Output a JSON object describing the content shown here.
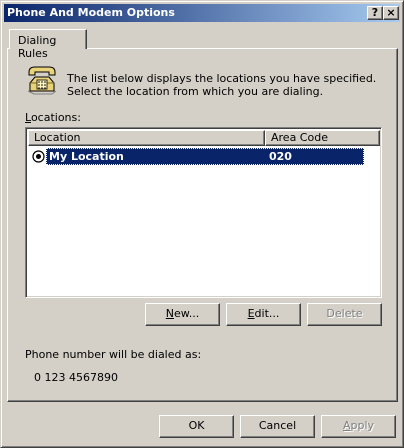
{
  "window": {
    "title": "Phone And Modem Options",
    "help_label": "?",
    "close_label": "×"
  },
  "tabs": [
    {
      "label": "Dialing Rules",
      "selected": true
    }
  ],
  "dialing_rules": {
    "description": "The list below displays the locations you have specified. Select the location from which you are dialing.",
    "locations_label_rest": "ocations:",
    "locations_label_mnemonic": "L",
    "columns": [
      "Location",
      "Area Code"
    ],
    "rows": [
      {
        "location": "My Location",
        "area_code": "020",
        "selected": true
      }
    ],
    "buttons": {
      "new_mnemonic": "N",
      "new_rest": "ew...",
      "edit_mnemonic": "E",
      "edit_rest": "dit...",
      "delete": "Delete"
    },
    "dial_as_label": "Phone number will be dialed as:",
    "dial_as_number": "0 123 4567890"
  },
  "footer": {
    "ok": "OK",
    "cancel": "Cancel",
    "apply_mnemonic": "A",
    "apply_rest": "pply"
  },
  "icons": {
    "phone": "telephone-icon",
    "radio": "radio-selected-icon"
  },
  "colors": {
    "titlebar_start": "#0a246a",
    "titlebar_end": "#a6caf0",
    "selection": "#0a246a",
    "face": "#d4d0c8"
  }
}
